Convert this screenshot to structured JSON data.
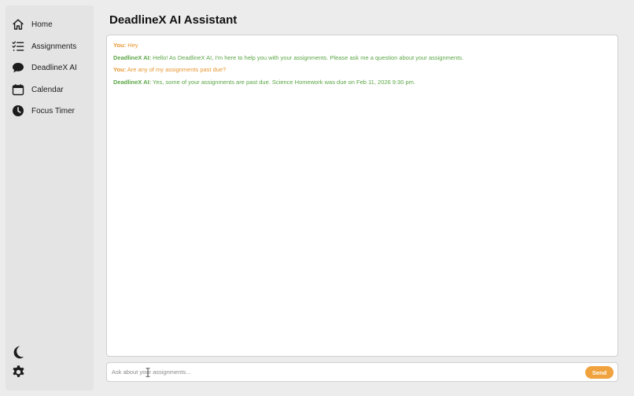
{
  "sidebar": {
    "items": [
      {
        "label": "Home",
        "icon": "home-icon"
      },
      {
        "label": "Assignments",
        "icon": "checklist-icon"
      },
      {
        "label": "DeadlineX AI",
        "icon": "chat-bubble-icon"
      },
      {
        "label": "Calendar",
        "icon": "calendar-icon"
      },
      {
        "label": "Focus Timer",
        "icon": "clock-icon"
      }
    ],
    "bottom_icons": [
      "moon-icon",
      "gear-icon"
    ]
  },
  "main": {
    "title": "DeadlineX AI Assistant",
    "messages": [
      {
        "role": "user",
        "sender": "You:",
        "text": "Hey"
      },
      {
        "role": "ai",
        "sender": "DeadlineX AI:",
        "text": "Hello! As DeadlineX AI, I'm here to help you with your assignments. Please ask me a question about your assignments."
      },
      {
        "role": "user",
        "sender": "You:",
        "text": "Are any of my assignments past due?"
      },
      {
        "role": "ai",
        "sender": "DeadlineX AI:",
        "text": "Yes, some of your assignments are past due. Science Homework was due on Feb 11, 2026 9:30 pm."
      }
    ],
    "input": {
      "placeholder": "Ask about your assignments...",
      "value": ""
    },
    "send_label": "Send"
  },
  "colors": {
    "user_message": "#e8962f",
    "ai_message": "#5aa645",
    "send_button": "#f0a23e",
    "background": "#ececec",
    "sidebar": "#e4e4e4"
  }
}
